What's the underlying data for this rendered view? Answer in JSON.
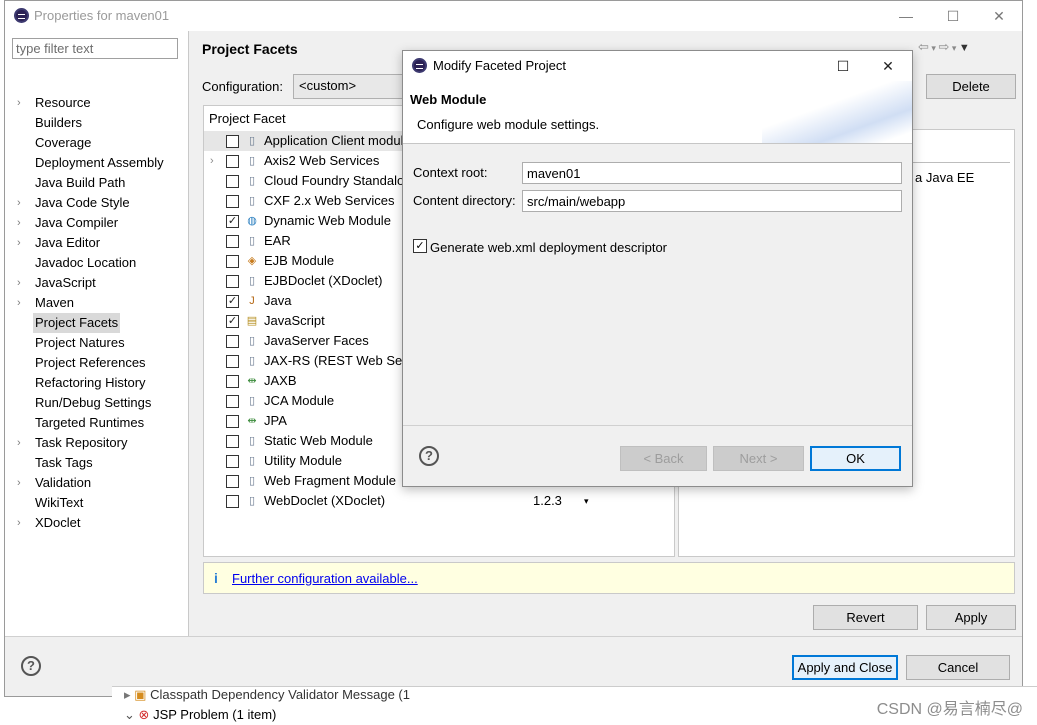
{
  "properties_window": {
    "title": "Properties for maven01",
    "filter_placeholder": "type filter text",
    "nav_items": [
      {
        "label": "Resource",
        "expandable": true
      },
      {
        "label": "Builders",
        "expandable": false
      },
      {
        "label": "Coverage",
        "expandable": false
      },
      {
        "label": "Deployment Assembly",
        "expandable": false
      },
      {
        "label": "Java Build Path",
        "expandable": false
      },
      {
        "label": "Java Code Style",
        "expandable": true
      },
      {
        "label": "Java Compiler",
        "expandable": true
      },
      {
        "label": "Java Editor",
        "expandable": true
      },
      {
        "label": "Javadoc Location",
        "expandable": false
      },
      {
        "label": "JavaScript",
        "expandable": true
      },
      {
        "label": "Maven",
        "expandable": true
      },
      {
        "label": "Project Facets",
        "expandable": false,
        "selected": true
      },
      {
        "label": "Project Natures",
        "expandable": false
      },
      {
        "label": "Project References",
        "expandable": false
      },
      {
        "label": "Refactoring History",
        "expandable": false
      },
      {
        "label": "Run/Debug Settings",
        "expandable": false
      },
      {
        "label": "Targeted Runtimes",
        "expandable": false
      },
      {
        "label": "Task Repository",
        "expandable": true
      },
      {
        "label": "Task Tags",
        "expandable": false
      },
      {
        "label": "Validation",
        "expandable": true
      },
      {
        "label": "WikiText",
        "expandable": false
      },
      {
        "label": "XDoclet",
        "expandable": true
      }
    ],
    "page_title": "Project Facets",
    "configuration_label": "Configuration:",
    "configuration_value": "<custom>",
    "delete_label": "Delete",
    "facet_column_header": "Project Facet",
    "facets": [
      {
        "label": "Application Client module",
        "checked": false,
        "icon": "doc-icon",
        "highlight": true
      },
      {
        "label": "Axis2 Web Services",
        "checked": false,
        "icon": "doc-icon",
        "expandable": true
      },
      {
        "label": "Cloud Foundry Standalone",
        "checked": false,
        "icon": "doc-icon"
      },
      {
        "label": "CXF 2.x Web Services",
        "checked": false,
        "icon": "doc-icon"
      },
      {
        "label": "Dynamic Web Module",
        "checked": true,
        "icon": "globe-icon"
      },
      {
        "label": "EAR",
        "checked": false,
        "icon": "doc-icon"
      },
      {
        "label": "EJB Module",
        "checked": false,
        "icon": "bean-icon"
      },
      {
        "label": "EJBDoclet (XDoclet)",
        "checked": false,
        "icon": "doc-icon"
      },
      {
        "label": "Java",
        "checked": true,
        "icon": "java-icon"
      },
      {
        "label": "JavaScript",
        "checked": true,
        "icon": "js-icon"
      },
      {
        "label": "JavaServer Faces",
        "checked": false,
        "icon": "doc-icon"
      },
      {
        "label": "JAX-RS (REST Web Services)",
        "checked": false,
        "icon": "doc-icon"
      },
      {
        "label": "JAXB",
        "checked": false,
        "icon": "arrows-icon"
      },
      {
        "label": "JCA Module",
        "checked": false,
        "icon": "doc-icon"
      },
      {
        "label": "JPA",
        "checked": false,
        "icon": "arrows-icon"
      },
      {
        "label": "Static Web Module",
        "checked": false,
        "icon": "doc-icon"
      },
      {
        "label": "Utility Module",
        "checked": false,
        "icon": "doc-icon"
      },
      {
        "label": "Web Fragment Module",
        "checked": false,
        "icon": "doc-icon"
      },
      {
        "label": "WebDoclet (XDoclet)",
        "checked": false,
        "icon": "doc-icon",
        "version": "1.2.3"
      }
    ],
    "description_text": "a Java EE",
    "further_config_link": "Further configuration available...",
    "revert_label": "Revert",
    "apply_label": "Apply",
    "apply_close_label": "Apply and Close",
    "cancel_label": "Cancel"
  },
  "background_view": {
    "line1": "Classpath Dependency Validator Message (1",
    "line2": "JSP Problem (1 item)"
  },
  "watermark": "CSDN @易言楠尽@",
  "modal": {
    "title": "Modify Faceted Project",
    "heading": "Web Module",
    "subtitle": "Configure web module settings.",
    "context_root_label": "Context root:",
    "context_root_value": "maven01",
    "content_dir_label": "Content directory:",
    "content_dir_value": "src/main/webapp",
    "generate_xml_label": "Generate web.xml deployment descriptor",
    "generate_xml_checked": true,
    "back_label": "< Back",
    "next_label": "Next >",
    "ok_label": "OK"
  },
  "colors": {
    "accent_blue": "#0078d7",
    "link": "#0000ee",
    "info_bar": "#ffffe1"
  }
}
